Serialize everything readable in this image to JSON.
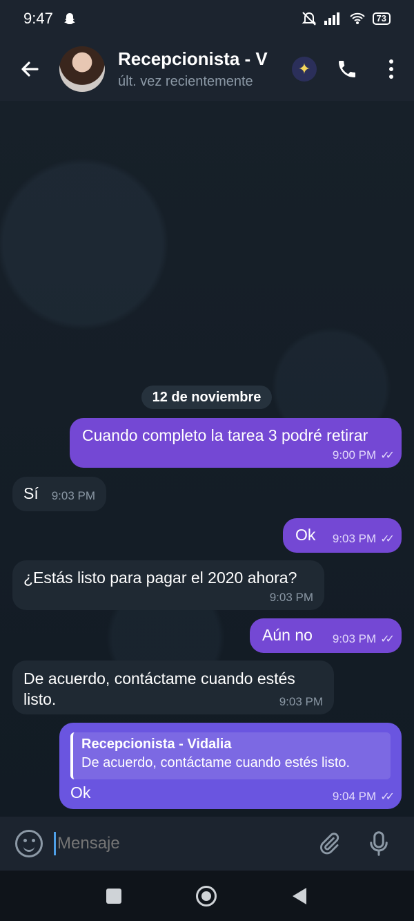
{
  "status": {
    "time": "9:47",
    "battery": "73"
  },
  "header": {
    "title": "Recepcionista - V",
    "subtitle": "últ. vez recientemente"
  },
  "chat": {
    "date": "12 de noviembre",
    "messages": [
      {
        "text": "Cuando completo la tarea 3 podré retirar",
        "time": "9:00 PM",
        "direction": "out"
      },
      {
        "text": "Sí",
        "time": "9:03 PM",
        "direction": "in"
      },
      {
        "text": "Ok",
        "time": "9:03 PM",
        "direction": "out"
      },
      {
        "text": "¿Estás listo para pagar el 2020 ahora?",
        "time": "9:03 PM",
        "direction": "in"
      },
      {
        "text": "Aún no",
        "time": "9:03 PM",
        "direction": "out"
      },
      {
        "text": "De acuerdo, contáctame cuando estés",
        "text_line2": "listo.",
        "time": "9:03 PM",
        "direction": "in"
      },
      {
        "reply_name": "Recepcionista - Vidalia",
        "reply_text": "De acuerdo, contáctame cuando estés listo.",
        "text": "Ok",
        "time": "9:04 PM",
        "direction": "out"
      }
    ]
  },
  "input": {
    "placeholder": "Mensaje"
  },
  "colors": {
    "outgoing": "#7448d4",
    "incoming": "#1f2933",
    "header": "#1c242f"
  }
}
